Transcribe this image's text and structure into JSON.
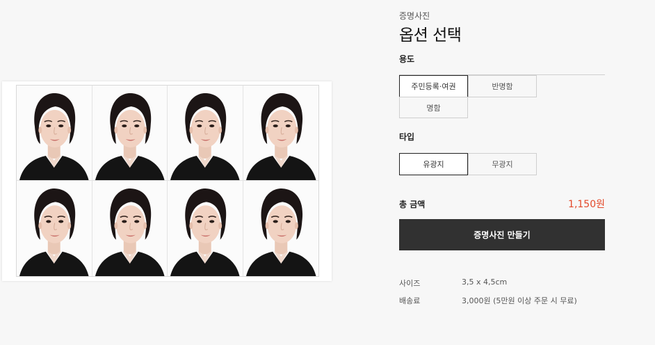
{
  "product": {
    "category": "증명사진",
    "title": "옵션 선택"
  },
  "usage": {
    "label": "용도",
    "options": [
      "주민등록·여권",
      "반명함",
      "명함"
    ],
    "selected": "주민등록·여권"
  },
  "type": {
    "label": "타입",
    "options": [
      "유광지",
      "무광지"
    ],
    "selected": "유광지"
  },
  "total": {
    "label": "총 금액",
    "price": "1,150원",
    "price_color": "#e3492a"
  },
  "cta": {
    "label": "증명사진 만들기"
  },
  "info": {
    "size_label": "사이즈",
    "size_value": "3,5 x 4,5cm",
    "shipping_label": "배송료",
    "shipping_value": "3,000원 (5만원 이상 주문 시 무료)"
  },
  "photo_sheet": {
    "photo_count": 8,
    "columns": 4,
    "rows": 2
  }
}
